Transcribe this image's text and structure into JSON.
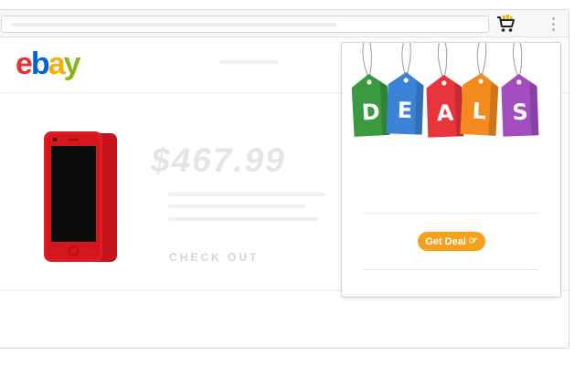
{
  "browser": {
    "extension_icon": "shopping-cart-icon",
    "menu_icon": "vertical-dots-icon"
  },
  "site": {
    "logo": {
      "letters": [
        "e",
        "b",
        "a",
        "y"
      ],
      "colors": [
        "#e53238",
        "#0064d2",
        "#f5af02",
        "#86b817"
      ]
    },
    "product": {
      "image": "red-smartphone-image",
      "price": "$467.99",
      "checkout_label": "CHECK OUT"
    }
  },
  "popup": {
    "tags": [
      {
        "letter": "D",
        "color": "#3a9a3f"
      },
      {
        "letter": "E",
        "color": "#3c82d6"
      },
      {
        "letter": "A",
        "color": "#e8343a"
      },
      {
        "letter": "L",
        "color": "#f28a1e"
      },
      {
        "letter": "S",
        "color": "#a24ec0"
      }
    ],
    "button": {
      "label": "Get Deal",
      "icon": "hand-pointer-icon",
      "color": "#f7a11a"
    }
  }
}
